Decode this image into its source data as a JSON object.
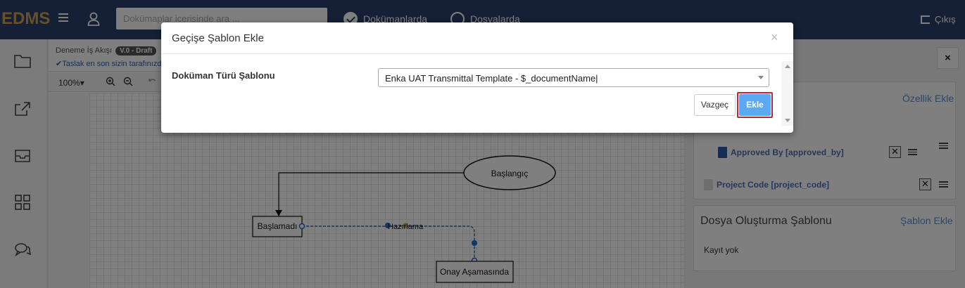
{
  "app": {
    "logo": "EDMS",
    "search_placeholder": "Dokümaplar icerisinde ara ...",
    "radio_documents": "Dokümanlarda",
    "radio_folders": "Dosyalarda",
    "logout": "Çıkış"
  },
  "canvas": {
    "workflow_name": "Deneme İş Akışı",
    "version_badge": "V.0 - Draft",
    "draft_note": "✔Taslak en son sizin tarafınızdan",
    "zoom_level": "100%",
    "nodes": {
      "start": "Başlangıç",
      "not_started": "Başlamadı",
      "preparing": "Hazırlama",
      "approval": "Onay Aşamasında"
    }
  },
  "right_panel": {
    "close": "×",
    "add_property": "Özellik Ekle",
    "attributes": [
      {
        "label": "Approved By [approved_by]"
      },
      {
        "label": "Project Code [project_code]"
      }
    ],
    "file_template_title": "Dosya Oluşturma Şablonu",
    "add_template": "Şablon Ekle",
    "no_record": "Kayıt yok"
  },
  "modal": {
    "title": "Geçişe Şablon Ekle",
    "close": "×",
    "field_label": "Doküman Türü Şablonu",
    "selected_value": "Enka UAT Transmittal Template - $_documentName|",
    "cancel_label": "Vazgeç",
    "add_label": "Ekle"
  },
  "colors": {
    "topbar": "#2b3f6b",
    "logo": "#c9a24a",
    "primary_button": "#5aa9f2",
    "highlight": "#c0282e"
  }
}
